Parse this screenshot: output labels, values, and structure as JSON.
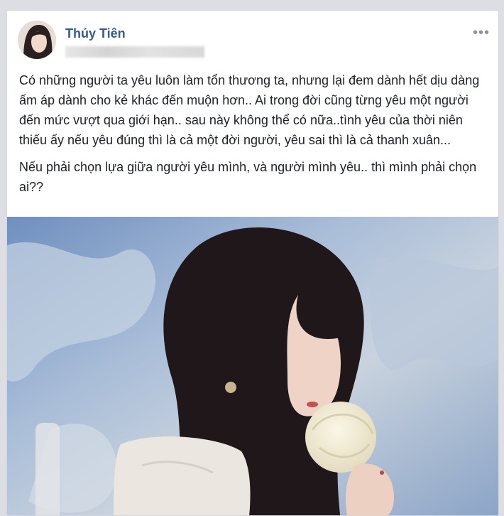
{
  "post": {
    "author": "Thủy Tiên",
    "menu_label": "•••",
    "paragraphs": [
      "Có những người ta yêu luôn làm tổn thương ta, nhưng lại đem dành hết dịu dàng ấm áp dành cho kẻ khác đến muộn hơn.. Ai trong đời cũng từng yêu một người đến mức vượt qua giới hạn.. sau này không thể có nữa..tình yêu của thời niên thiếu ấy nếu yêu đúng thì là cả một đời người, yêu sai thì là cả thanh xuân...",
      "Nếu phải chọn lựa giữa người yêu mình, và người mình yêu.. thì mình phải chọn ai??"
    ]
  },
  "colors": {
    "author_link": "#365899",
    "text": "#1d2129",
    "card_bg": "#ffffff",
    "page_bg": "#dcdee3"
  }
}
